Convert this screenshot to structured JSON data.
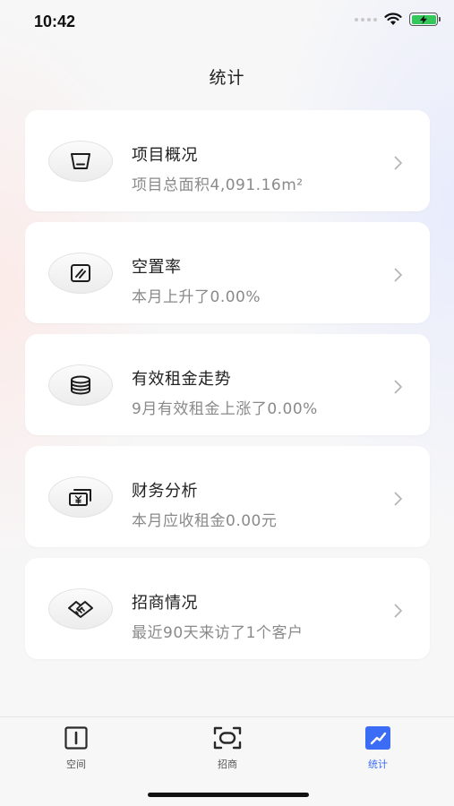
{
  "status_bar": {
    "time": "10:42",
    "icons": [
      "signal-dots-icon",
      "wifi-icon",
      "battery-charging-icon"
    ]
  },
  "header": {
    "title": "统计"
  },
  "cards": [
    {
      "title": "项目概况",
      "subtitle": "项目总面积4,091.16m²",
      "icon": "area-icon"
    },
    {
      "title": "空置率",
      "subtitle": "本月上升了0.00%",
      "icon": "vacancy-icon"
    },
    {
      "title": "有效租金走势",
      "subtitle": "9月有效租金上涨了0.00%",
      "icon": "coins-stack-icon"
    },
    {
      "title": "财务分析",
      "subtitle": "本月应收租金0.00元",
      "icon": "yuan-bill-icon"
    },
    {
      "title": "招商情况",
      "subtitle": "最近90天来访了1个客户",
      "icon": "handshake-icon"
    }
  ],
  "tab_bar": {
    "items": [
      {
        "label": "空间",
        "icon": "space-icon",
        "active": false
      },
      {
        "label": "招商",
        "icon": "scan-frame-icon",
        "active": false
      },
      {
        "label": "统计",
        "icon": "trend-chart-icon",
        "active": true
      }
    ]
  },
  "colors": {
    "accent": "#3b6cf5",
    "battery": "#34c759",
    "subtitle": "#8a8a8a"
  }
}
